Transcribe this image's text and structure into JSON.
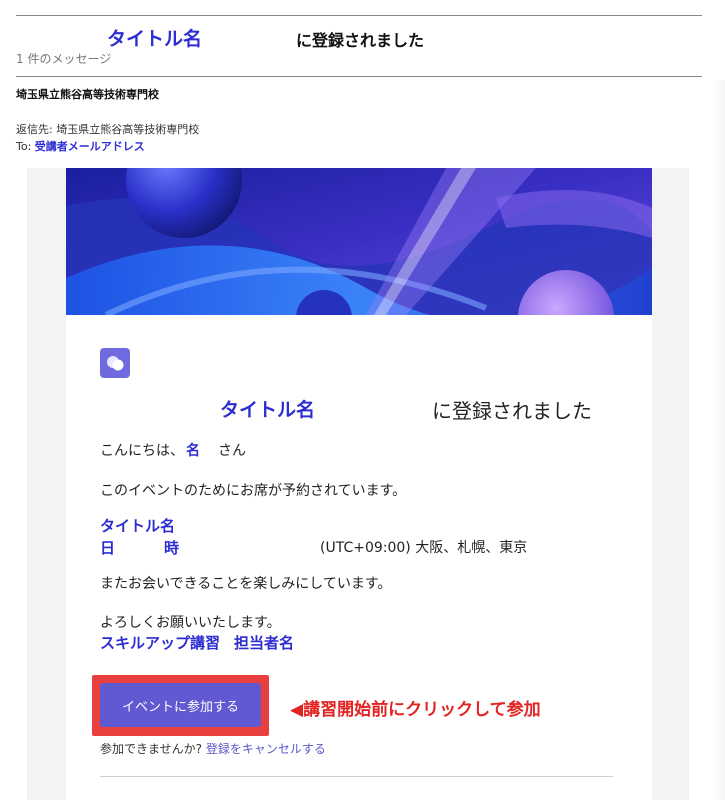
{
  "email": {
    "subject_title": "タイトル名",
    "subject_rest": "に登録されました",
    "message_count": "1 件のメッセージ",
    "sender": "埼玉県立熊谷高等技術専門校",
    "reply_to_label": "返信先:",
    "reply_to_value": "埼玉県立熊谷高等技術専門校",
    "to_label": "To:",
    "to_value": "受講者メールアドレス"
  },
  "body": {
    "heading_title": "タイトル名",
    "heading_rest": "に登録されました",
    "greeting_prefix": "こんにちは、",
    "greeting_name": "名",
    "greeting_suffix": "さん",
    "reserved_text": "このイベントのためにお席が予約されています。",
    "event_title": "タイトル名",
    "event_date_day": "日",
    "event_date_time": "時",
    "event_timezone": "(UTC+09:00) 大阪、札幌、東京",
    "looking_forward": "またお会いできることを楽しみにしています。",
    "regards": "よろしくお願いいたします。",
    "signer_course": "スキルアップ講習",
    "signer_person": "担当者名",
    "join_button": "イベントに参加する",
    "callout": "◀講習開始前にクリックして参加",
    "cant_attend_prefix": "参加できませんか?",
    "cancel_link": "登録をキャンセルする"
  },
  "colors": {
    "accent_blue": "#2d2dd2",
    "button_purple": "#6059d1",
    "highlight_red": "#e8403f",
    "link_purple": "#5b57c8"
  }
}
